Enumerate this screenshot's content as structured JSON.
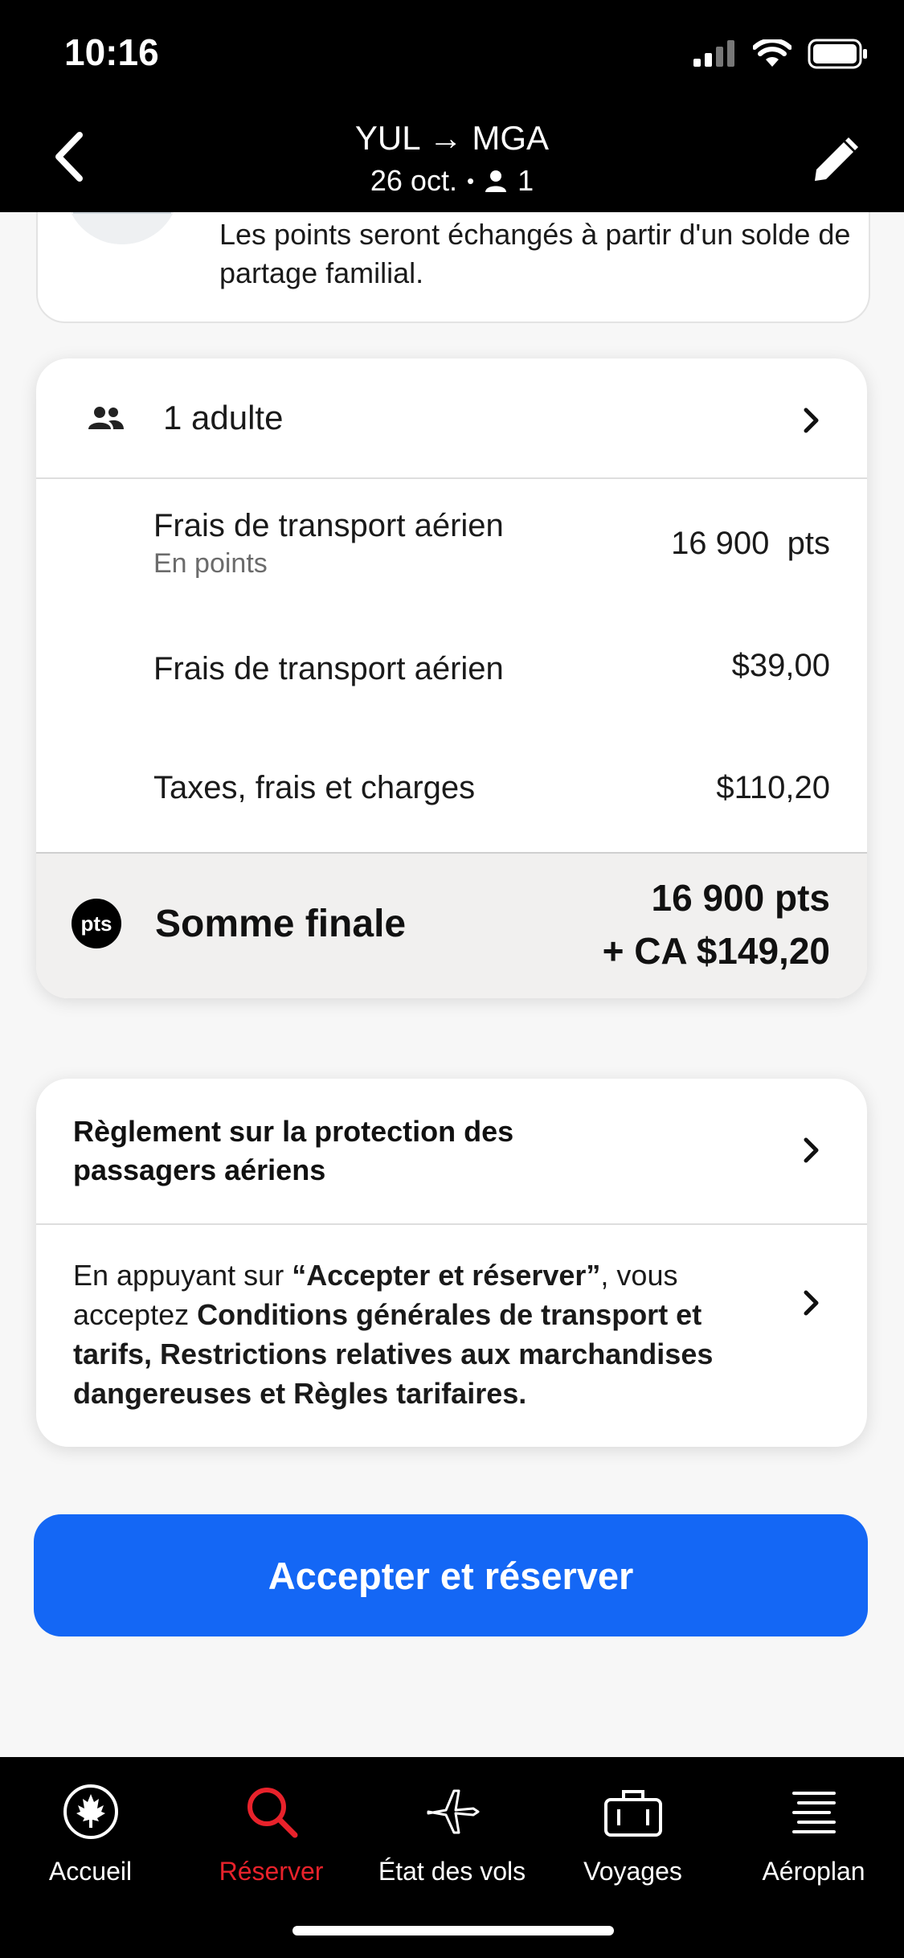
{
  "status": {
    "time": "10:16"
  },
  "nav": {
    "route": "YUL → MGA",
    "date": "26 oct.",
    "bullet": "•",
    "passengers": "1"
  },
  "notice": {
    "text": "Les points seront échangés à partir d'un solde de partage familial."
  },
  "fare": {
    "header_label": "1 adulte",
    "lines": [
      {
        "label": "Frais de transport aérien",
        "sublabel": "En points",
        "value": "16 900  pts"
      },
      {
        "label": "Frais de transport aérien",
        "value": "$39,00"
      },
      {
        "label": "Taxes, frais et charges",
        "value": "$110,20"
      }
    ],
    "total": {
      "badge": "pts",
      "label": "Somme finale",
      "points": "16 900 pts",
      "cash": "+ CA $149,20"
    }
  },
  "policy": {
    "title": "Règlement sur la protection des passagers aériens",
    "terms_prefix": "En appuyant sur ",
    "terms_button_name": "“Accepter et réserver”",
    "terms_middle": ", vous acceptez ",
    "terms_links": "Conditions générales de transport et tarifs, Restrictions relatives aux marchandises dangereuses et Règles tarifaires."
  },
  "cta": {
    "label": "Accepter et réserver"
  },
  "tabs": [
    {
      "label": "Accueil",
      "icon": "maple-leaf-icon",
      "active": false
    },
    {
      "label": "Réserver",
      "icon": "search-icon",
      "active": true
    },
    {
      "label": "État des vols",
      "icon": "airplane-icon",
      "active": false
    },
    {
      "label": "Voyages",
      "icon": "suitcase-icon",
      "active": false
    },
    {
      "label": "Aéroplan",
      "icon": "aeroplan-icon",
      "active": false
    }
  ],
  "colors": {
    "accent": "#1467f5",
    "active_tab": "#e8222b",
    "header_bg": "#000000"
  }
}
